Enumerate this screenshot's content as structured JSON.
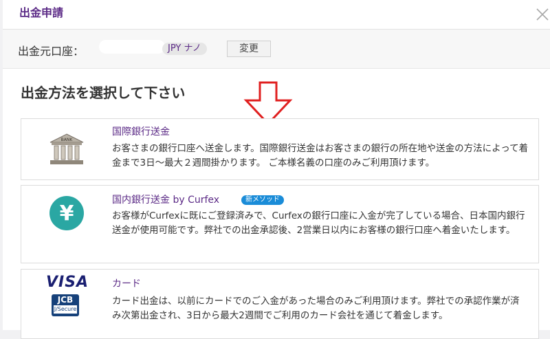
{
  "modal": {
    "title": "出金申請"
  },
  "source": {
    "label": "出金元口座：",
    "currency_tag": "JPY ナノ",
    "change_label": "変更"
  },
  "section": {
    "title": "出金方法を選択して下さい"
  },
  "methods": [
    {
      "title": "国際銀行送金",
      "icon": "bank-icon",
      "icon_text": "BANK",
      "description": "お客さまの銀行口座へ送金します。国際銀行送金はお客さまの銀行の所在地や送金の方法によって着金まで3日～最大２週間掛かります。 ご本様名義の口座のみご利用頂けます。"
    },
    {
      "title": "国内銀行送金 by Curfex",
      "badge": "新メソッド",
      "icon": "yen-icon",
      "icon_text": "¥",
      "description": "お客様がCurfexに既にご登録済みで、Curfexの銀行口座に入金が完了している場合、日本国内銀行送金が使用可能です。弊社での出金承認後、2営業日以内にお客様の銀行口座へ着金いたします。"
    },
    {
      "title": "カード",
      "icon": "visa-jcb-icon",
      "visa_text": "VISA",
      "jcb_text": "JCB",
      "jcb_sub": "J/Secure",
      "description": "カード出金は、以前にカードでのご入金があった場合のみご利用頂けます。弊社での承認作業が済み次第出金され、3日から最大2週間でご利用のカード会社を通じて着金します。"
    }
  ],
  "colors": {
    "accent": "#5b2a86",
    "badge": "#1a8cd8",
    "yen": "#2aa7a3",
    "annotation": "#e02020"
  }
}
